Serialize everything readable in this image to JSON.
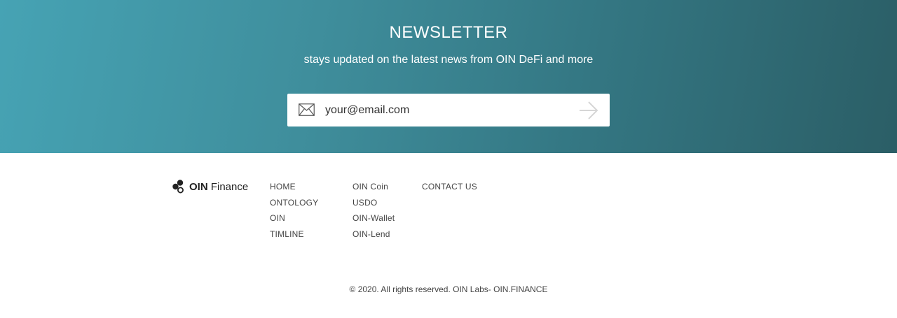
{
  "newsletter": {
    "title": "NEWSLETTER",
    "subtitle": "stays updated on the latest news from OIN DeFi and more",
    "email_placeholder": "your@email.com",
    "mail_icon": "envelope-icon",
    "submit_icon": "arrow-right-icon"
  },
  "footer": {
    "logo": {
      "brand": "OIN",
      "suffix": " Finance"
    },
    "columns": [
      {
        "links": [
          "HOME",
          "ONTOLOGY",
          "OIN",
          "TIMLINE"
        ]
      },
      {
        "links": [
          "OIN Coin",
          "USDO",
          "OIN-Wallet",
          "OIN-Lend"
        ]
      },
      {
        "links": [
          "CONTACT US"
        ]
      }
    ],
    "copyright": "© 2020. All rights reserved. OIN Labs- OIN.FINANCE"
  },
  "colors": {
    "hero_gradient_start": "#46a3b4",
    "hero_gradient_end": "#2b5e66",
    "text_dark": "#222222",
    "link_text": "#444444"
  }
}
